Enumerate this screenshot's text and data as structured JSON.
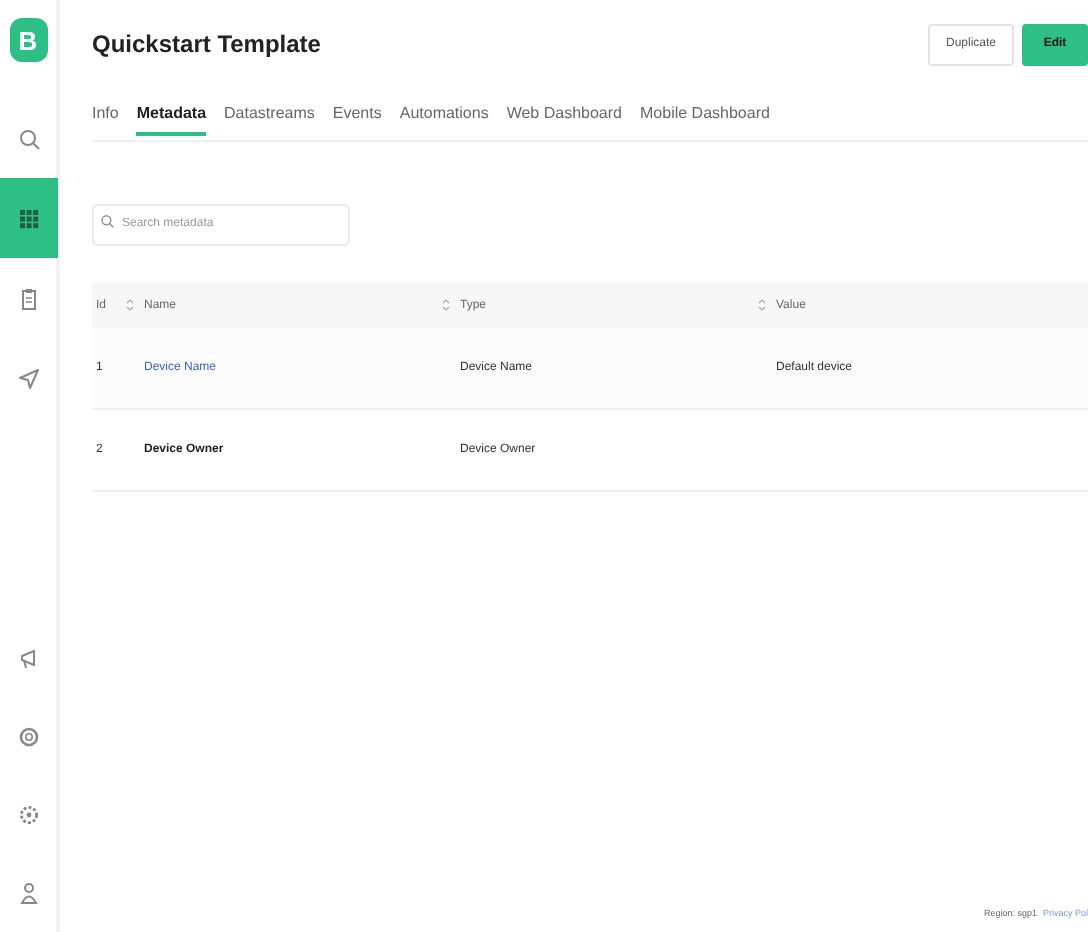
{
  "logo": {
    "letter": "B"
  },
  "sidebar": {
    "items": [
      {
        "kind": "search",
        "selected": false
      },
      {
        "kind": "grid",
        "selected": true
      },
      {
        "kind": "clipboard",
        "selected": false
      },
      {
        "kind": "send",
        "selected": false
      }
    ],
    "bottom_items": [
      {
        "kind": "megaphone",
        "selected": false
      },
      {
        "kind": "help",
        "selected": false
      },
      {
        "kind": "gear",
        "selected": false
      },
      {
        "kind": "user",
        "selected": false
      }
    ]
  },
  "header": {
    "title": "Quickstart Template",
    "buttons": [
      {
        "label": "Duplicate",
        "kind": "secondary"
      },
      {
        "label": "Edit",
        "kind": "primary"
      }
    ]
  },
  "tabs": [
    {
      "label": "Info",
      "selected": false
    },
    {
      "label": "Metadata",
      "selected": true
    },
    {
      "label": "Datastreams",
      "selected": false
    },
    {
      "label": "Events",
      "selected": false
    },
    {
      "label": "Automations",
      "selected": false
    },
    {
      "label": "Web Dashboard",
      "selected": false
    },
    {
      "label": "Mobile Dashboard",
      "selected": false
    }
  ],
  "search": {
    "placeholder": "Search metadata"
  },
  "table": {
    "columns": [
      {
        "label": "Id",
        "sortable": true
      },
      {
        "label": "Name",
        "sortable": true
      },
      {
        "label": "Type",
        "sortable": true
      },
      {
        "label": "Value",
        "sortable": false
      }
    ],
    "rows": [
      {
        "id": "1",
        "name": "Device Name",
        "link": true,
        "type": "Device Name",
        "value": "Default device"
      },
      {
        "id": "2",
        "name": "Device Owner",
        "link": false,
        "type": "Device Owner"
      }
    ]
  },
  "footer": {
    "region": "Region: sgp1",
    "link": "Privacy Pol"
  }
}
